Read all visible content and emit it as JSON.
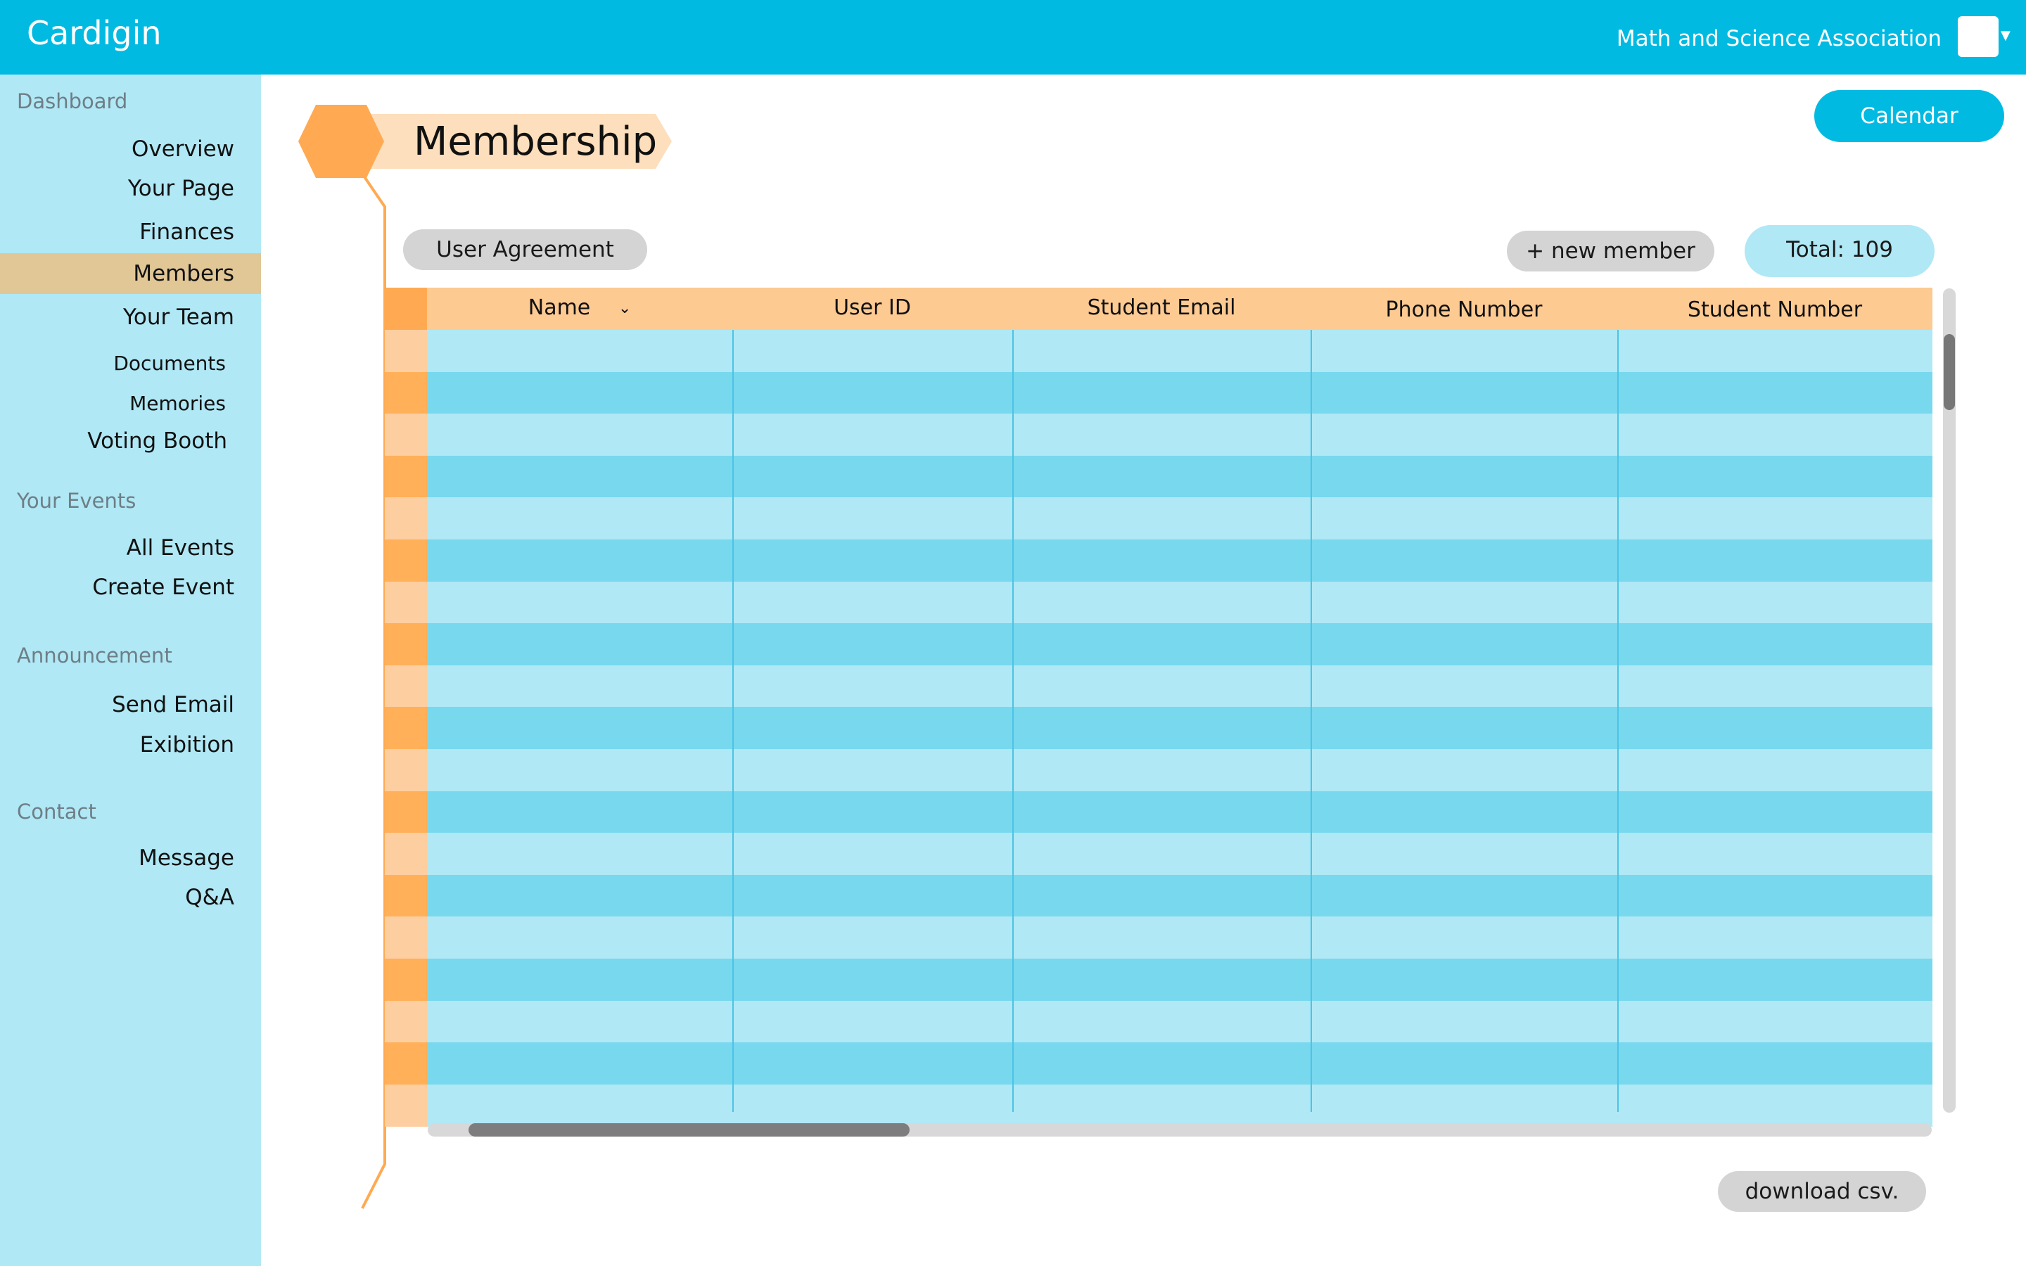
{
  "header": {
    "app_title": "Cardigin",
    "org_name": "Math and Science Association"
  },
  "sidebar": {
    "sections": [
      {
        "label": "Dashboard",
        "items": [
          "Overview",
          "Your Page",
          "Finances",
          "Members",
          "Your Team",
          "Documents",
          "Memories",
          "Voting Booth"
        ]
      },
      {
        "label": "Your Events",
        "items": [
          "All Events",
          "Create Event"
        ]
      },
      {
        "label": "Announcement",
        "items": [
          "Send Email",
          "Exibition"
        ]
      },
      {
        "label": "Contact",
        "items": [
          "Message",
          "Q&A"
        ]
      }
    ],
    "active_item": "Members"
  },
  "main": {
    "calendar_label": "Calendar",
    "page_title": "Membership",
    "user_agreement_label": "User Agreement",
    "new_member_label": "+ new member",
    "total_label": "Total: 109",
    "download_label": "download csv.",
    "table": {
      "columns": [
        "Name",
        "User ID",
        "Student Email",
        "Phone Number",
        "Student Number"
      ],
      "sort_column": "Name",
      "row_count": 19
    }
  },
  "colors": {
    "accent": "#00bae2",
    "sidebar_bg": "#b0e8f5",
    "active_item_bg": "#e1c796",
    "orange": "#ffaa52",
    "header_row": "#fdca92",
    "row_light": "#b0e8f5",
    "row_dark": "#78d8ee"
  }
}
